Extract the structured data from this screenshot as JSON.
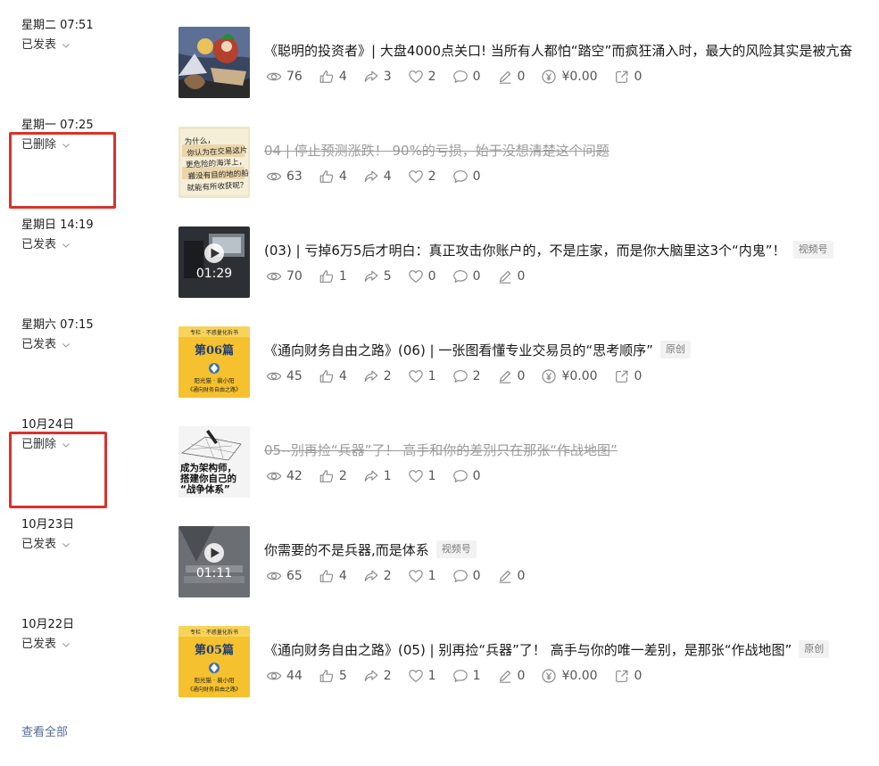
{
  "articles": [
    {
      "date": "星期二 07:51",
      "status": "已发表",
      "title": "《聪明的投资者》| 大盘4000点关口! 当所有人都怕“踏空”而疯狂涌入时，最大的风险其实是被亢奋",
      "deleted": false,
      "tag": "",
      "thumb": "painting",
      "stats": {
        "views": "76",
        "likes": "4",
        "shares": "3",
        "wows": "2",
        "comments": "0",
        "notes": "0",
        "reward": "¥0.00",
        "forwards": "0"
      }
    },
    {
      "date": "星期一 07:25",
      "status": "已删除",
      "title": "04 | 停止预测涨跌！ 90%的亏损，始于没想清楚这个问题",
      "deleted": true,
      "tag": "",
      "thumb": "handwriting",
      "thumb_text": [
        "为什么，",
        "你认为在交易这片",
        "更危险的海洋上，",
        "搬没有目的地的船",
        "就能有所收获呢？"
      ],
      "stats": {
        "views": "63",
        "likes": "4",
        "shares": "4",
        "wows": "2",
        "comments": "0"
      }
    },
    {
      "date": "星期日 14:19",
      "status": "已发表",
      "title": "(03) | 亏掉6万5后才明白：真正攻击你账户的，不是庄家，而是你大脑里这3个“内鬼”！",
      "deleted": false,
      "tag": "视频号",
      "thumb": "video-dark",
      "duration": "01:29",
      "stats": {
        "views": "70",
        "likes": "1",
        "shares": "5",
        "wows": "0",
        "comments": "0",
        "notes": "0"
      }
    },
    {
      "date": "星期六 07:15",
      "status": "已发表",
      "title": "《通向财务自由之路》(06) | 一张图看懂专业交易员的“思考顺序”",
      "deleted": false,
      "tag": "原创",
      "thumb": "book",
      "thumb_top": "专栏 · 不惑量化拆书",
      "thumb_issue": "第06篇",
      "thumb_authors": "阳光猫  ·  裴小阳",
      "thumb_bottom": "《通向财务自由之路》",
      "stats": {
        "views": "45",
        "likes": "4",
        "shares": "2",
        "wows": "1",
        "comments": "2",
        "notes": "0",
        "reward": "¥0.00",
        "forwards": "0"
      }
    },
    {
      "date": "10月24日",
      "status": "已删除",
      "title": "05--别再捡“兵器”了！ 高手和你的差别只在那张“作战地图”",
      "deleted": true,
      "tag": "",
      "thumb": "sketch",
      "thumb_text": [
        "成为架构师，",
        "搭建你自己的",
        "“战争体系”"
      ],
      "stats": {
        "views": "42",
        "likes": "2",
        "shares": "1",
        "wows": "1",
        "comments": "0"
      }
    },
    {
      "date": "10月23日",
      "status": "已发表",
      "title": "你需要的不是兵器,而是体系",
      "deleted": false,
      "tag": "视频号",
      "thumb": "video-gray",
      "duration": "01:11",
      "stats": {
        "views": "65",
        "likes": "4",
        "shares": "2",
        "wows": "1",
        "comments": "0",
        "notes": "0"
      }
    },
    {
      "date": "10月22日",
      "status": "已发表",
      "title": "《通向财务自由之路》(05) | 别再捡“兵器”了！ 高手与你的唯一差别，是那张“作战地图”",
      "deleted": false,
      "tag": "原创",
      "thumb": "book",
      "thumb_top": "专栏 · 不惑量化拆书",
      "thumb_issue": "第05篇",
      "thumb_authors": "阳光猫  ·  裴小阳",
      "thumb_bottom": "《通向财务自由之路》",
      "stats": {
        "views": "44",
        "likes": "5",
        "shares": "2",
        "wows": "1",
        "comments": "1",
        "notes": "0",
        "reward": "¥0.00",
        "forwards": "0"
      }
    }
  ],
  "view_all_label": "查看全部",
  "colors": {
    "highlight": "#d9322b",
    "link": "#576b95",
    "book_yellow": "#f5c12e"
  }
}
